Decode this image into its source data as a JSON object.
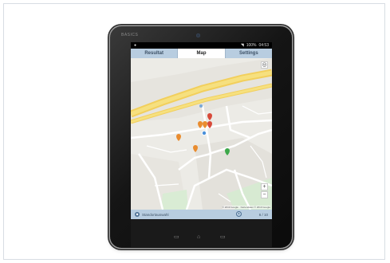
{
  "tablet": {
    "brand": "BASICS",
    "statusbar": {
      "notification_icon": "android-icon",
      "battery": "100%",
      "time": "04:53"
    }
  },
  "tabs": [
    {
      "label": "Resultat",
      "active": false
    },
    {
      "label": "Map",
      "active": true
    },
    {
      "label": "Settings",
      "active": false
    }
  ],
  "map": {
    "zoom_in": "+",
    "zoom_out": "−",
    "attribution": "© 2019 Google · Kartendaten © 2019 Google",
    "markers": [
      {
        "color": "#d84a3a",
        "type": "pin"
      },
      {
        "color": "#e98c2f",
        "type": "pin"
      },
      {
        "color": "#e98c2f",
        "type": "pin"
      },
      {
        "color": "#d84a3a",
        "type": "pin"
      },
      {
        "color": "#e98c2f",
        "type": "pin"
      },
      {
        "color": "#3da84a",
        "type": "pin"
      },
      {
        "color": "#4a90d9",
        "type": "location-dot"
      }
    ]
  },
  "bottombar": {
    "location_label": "Standortauswahl",
    "history_icon": "clock-icon",
    "count": "6 / 10"
  },
  "navbar": {
    "back": "back-icon",
    "home": "home-icon",
    "recents": "recents-icon"
  }
}
